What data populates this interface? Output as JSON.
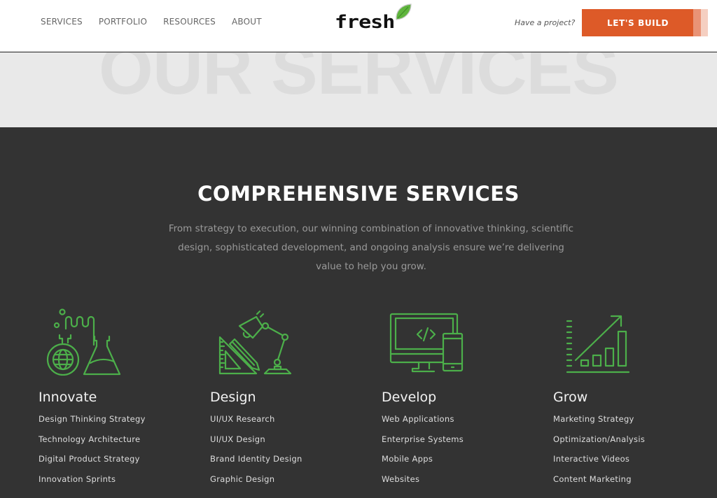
{
  "header": {
    "nav": [
      "SERVICES",
      "PORTFOLIO",
      "RESOURCES",
      "ABOUT"
    ],
    "logo_text": "fresh",
    "project_prompt": "Have a project?",
    "cta_label": "LET'S BUILD",
    "colors": {
      "accent": "#dd5a28",
      "leaf": "#5fb53d"
    }
  },
  "hero": {
    "title": "OUR SERVICES"
  },
  "services": {
    "title": "COMPREHENSIVE SERVICES",
    "description": "From strategy to execution, our winning combination of innovative thinking, scientific design, sophisticated development, and ongoing analysis ensure we’re delivering value to help you grow.",
    "icon_color": "#4caf4a",
    "columns": [
      {
        "icon": "lab-flask-globe-icon",
        "title": "Innovate",
        "items": [
          "Design Thinking Strategy",
          "Technology Architecture",
          "Digital Product Strategy",
          "Innovation Sprints"
        ]
      },
      {
        "icon": "desk-lamp-ruler-pencil-icon",
        "title": "Design",
        "items": [
          "UI/UX Research",
          "UI/UX Design",
          "Brand Identity Design",
          "Graphic Design"
        ]
      },
      {
        "icon": "monitor-phone-code-icon",
        "title": "Develop",
        "items": [
          "Web Applications",
          "Enterprise Systems",
          "Mobile Apps",
          "Websites"
        ]
      },
      {
        "icon": "growth-chart-icon",
        "title": "Grow",
        "items": [
          "Marketing Strategy",
          "Optimization/Analysis",
          "Interactive Videos",
          "Content Marketing"
        ]
      }
    ]
  }
}
